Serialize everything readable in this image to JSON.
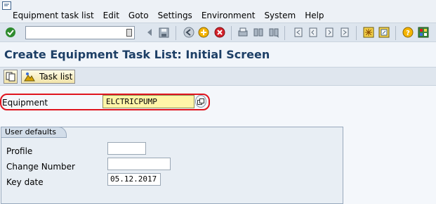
{
  "menu": {
    "items": [
      "Equipment task list",
      "Edit",
      "Goto",
      "Settings",
      "Environment",
      "System",
      "Help"
    ]
  },
  "toolbar": {
    "icons": [
      "enter-icon",
      "command-field",
      "back-arrow-icon",
      "save-icon",
      "back-icon",
      "exit-icon",
      "cancel-icon",
      "print-icon",
      "find-icon",
      "find-next-icon",
      "first-page-icon",
      "previous-page-icon",
      "next-page-icon",
      "last-page-icon",
      "create-session-icon",
      "shortcut-icon",
      "help-icon",
      "customize-layout-icon"
    ]
  },
  "title": "Create Equipment Task List: Initial Screen",
  "app_toolbar": {
    "task_list_label": "Task list"
  },
  "form": {
    "equipment_label": "Equipment",
    "equipment_value": "ELCTRICPUMP",
    "group_title": "User defaults",
    "profile_label": "Profile",
    "profile_value": "",
    "change_number_label": "Change Number",
    "change_number_value": "",
    "key_date_label": "Key date",
    "key_date_value": "05.12.2017"
  },
  "colors": {
    "title": "#1d3f66",
    "highlight_border": "#e0141e",
    "required_field": "#fff5a8"
  }
}
